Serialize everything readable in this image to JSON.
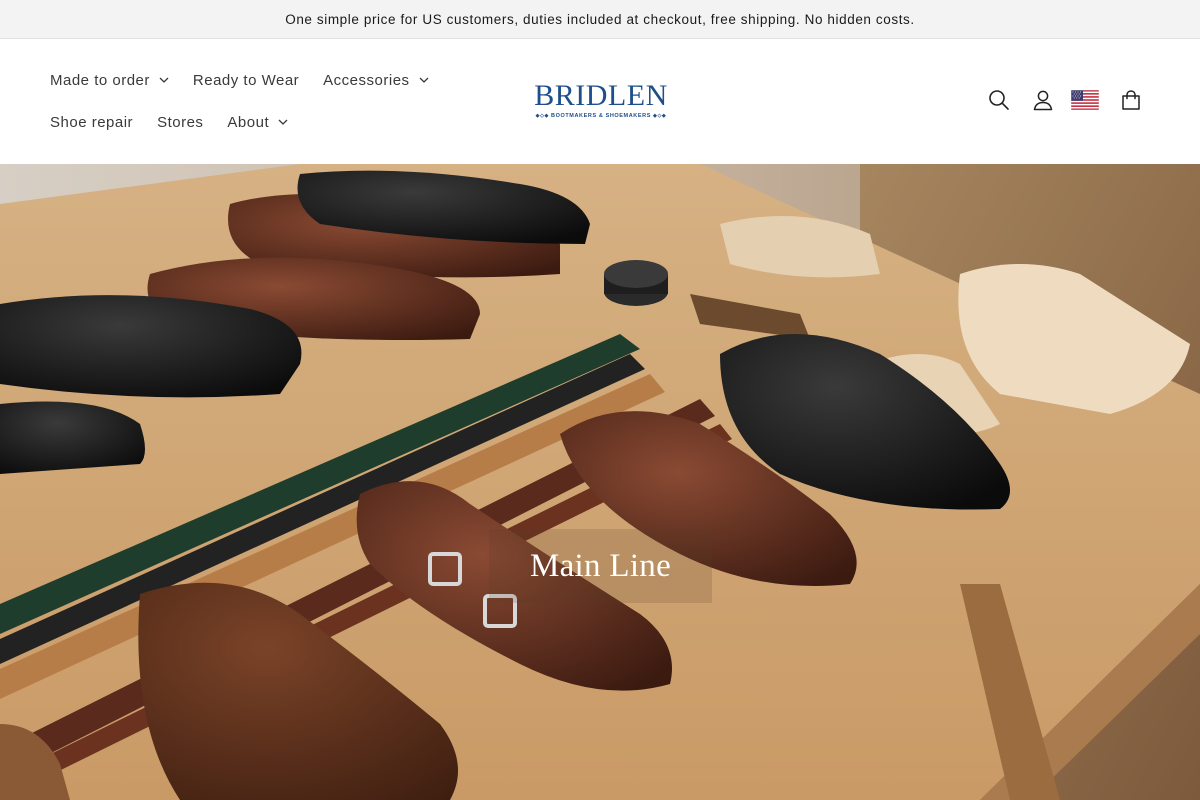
{
  "announcement": {
    "text": "One simple price for US customers, duties included at checkout, free shipping. No hidden costs."
  },
  "nav": {
    "row1": [
      {
        "label": "Made to order",
        "has_dropdown": true
      },
      {
        "label": "Ready to Wear",
        "has_dropdown": false
      },
      {
        "label": "Accessories",
        "has_dropdown": true
      }
    ],
    "row2": [
      {
        "label": "Shoe repair",
        "has_dropdown": false
      },
      {
        "label": "Stores",
        "has_dropdown": false
      },
      {
        "label": "About",
        "has_dropdown": true
      }
    ]
  },
  "logo": {
    "wordmark": "BRIDLEN",
    "tagline": "BOOTMAKERS & SHOEMAKERS",
    "color": "#1e4f8a"
  },
  "header_icons": [
    "search-icon",
    "account-icon",
    "us-flag-icon",
    "cart-icon"
  ],
  "hero": {
    "label": "Main Line"
  }
}
